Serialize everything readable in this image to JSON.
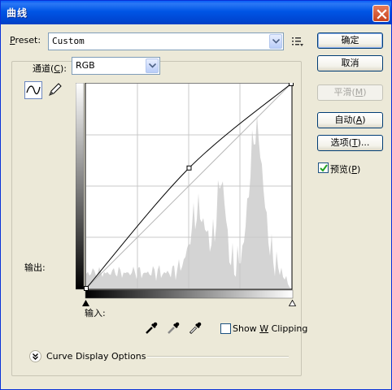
{
  "window": {
    "title": "曲线"
  },
  "preset": {
    "label_prefix": "P",
    "label_rest": "reset:",
    "value": "Custom"
  },
  "channel": {
    "label_prefix": "通道(",
    "label_key": "C",
    "label_suffix": "):",
    "value": "RGB"
  },
  "buttons": {
    "ok": "确定",
    "cancel": "取消",
    "smooth_prefix": "平滑(",
    "smooth_key": "M",
    "smooth_suffix": ")",
    "auto_prefix": "自动(",
    "auto_key": "A",
    "auto_suffix": ")",
    "options_prefix": "选项(",
    "options_key": "T",
    "options_suffix": ")..."
  },
  "preview": {
    "label_prefix": "预览(",
    "label_key": "P",
    "label_suffix": ")",
    "checked": true
  },
  "graph": {
    "output_label": "输出:",
    "input_label": "输入:",
    "curve_points": [
      [
        0,
        0
      ],
      [
        128,
        150
      ],
      [
        255,
        255
      ]
    ]
  },
  "show_clipping": {
    "label_prefix": "Show ",
    "label_key": "W",
    "label_suffix": " Clipping",
    "checked": false
  },
  "curve_display_options": {
    "label": "Curve Display Options"
  },
  "colors": {
    "title_bar": "#0055e5",
    "dialog_bg": "#ece9d8",
    "curve": "#000000",
    "histogram": "#d4d4d4",
    "grid": "#c8c8c8"
  }
}
